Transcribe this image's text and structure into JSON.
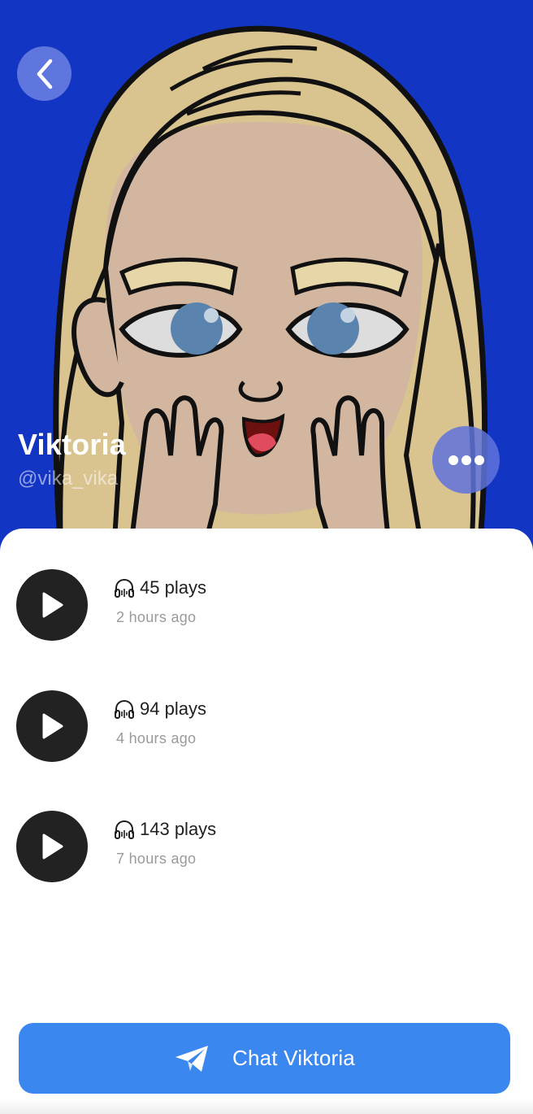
{
  "profile": {
    "name": "Viktoria",
    "handle": "@vika_vika"
  },
  "icons": {
    "back": "chevron-left-icon",
    "more": "more-dots-icon",
    "play": "play-icon",
    "plays": "headphones-icon",
    "send": "paper-plane-icon"
  },
  "tracks": [
    {
      "plays": "45 plays",
      "time": "2 hours ago"
    },
    {
      "plays": "94 plays",
      "time": "4 hours ago"
    },
    {
      "plays": "143 plays",
      "time": "7 hours ago"
    }
  ],
  "chat_button": {
    "label": "Chat Viktoria"
  },
  "colors": {
    "hero_background": "#1335c4",
    "chat_button": "#3b87f0",
    "play_button": "#222222"
  }
}
